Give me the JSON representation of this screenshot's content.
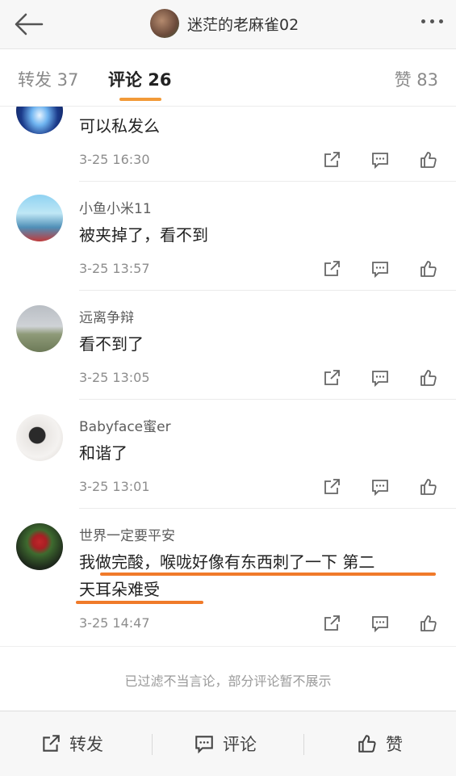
{
  "header": {
    "title": "迷茫的老麻雀02",
    "back_icon": "back-arrow-icon",
    "more_icon": "more-dots-icon"
  },
  "tabs": {
    "repost": "转发 37",
    "comments": "评论 26",
    "likes": "赞 83"
  },
  "comments": [
    {
      "name": "",
      "text": "可以私发么",
      "time": "3-25 16:30"
    },
    {
      "name": "小鱼小米11",
      "text": "被夹掉了，看不到",
      "time": "3-25 13:57"
    },
    {
      "name": "远离争辩",
      "text": "看不到了",
      "time": "3-25 13:05"
    },
    {
      "name": "Babyface蜜er",
      "text": "和谐了",
      "time": "3-25 13:01"
    },
    {
      "name": "世界一定要平安",
      "text_line1": "我做完酸，喉咙好像有东西刺了一下 第二",
      "text_line2": "天耳朵难受",
      "time": "3-25 14:47"
    }
  ],
  "comment_actions": [
    "share-icon",
    "reply-icon",
    "like-icon"
  ],
  "filter_note": "已过滤不当言论，部分评论暂不展示",
  "bottom_bar": {
    "repost": "转发",
    "comment": "评论",
    "like": "赞"
  },
  "colors": {
    "accent": "#f29a38",
    "highlight_underline": "#f07a2a"
  }
}
